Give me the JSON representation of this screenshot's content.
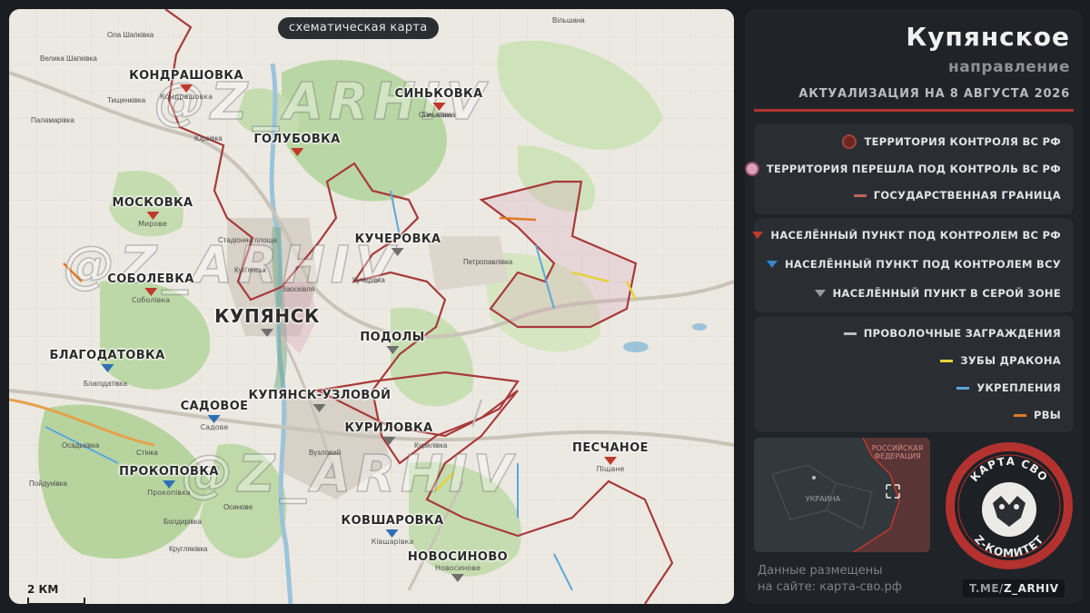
{
  "map": {
    "title": "схематическая карта",
    "scale_label": "2 КМ",
    "watermark": "@Z_ARHIV",
    "settlements": [
      {
        "name": "КОНДРАШОВКА",
        "sub": "Кондрашовка",
        "status": "ru",
        "big": false
      },
      {
        "name": "СИНЬКОВКА",
        "sub": "Сиьківка",
        "status": "ru",
        "big": false
      },
      {
        "name": "ГОЛУБОВКА",
        "sub": "",
        "status": "ru",
        "big": false
      },
      {
        "name": "МОСКОВКА",
        "sub": "Мирове",
        "status": "ru",
        "big": false
      },
      {
        "name": "КУЧЕРОВКА",
        "sub": "",
        "status": "gray",
        "big": false
      },
      {
        "name": "СОБОЛЕВКА",
        "sub": "Соболівка",
        "status": "ru",
        "big": false
      },
      {
        "name": "КУПЯНСК",
        "sub": "",
        "status": "gray",
        "big": true
      },
      {
        "name": "ПОДОЛЫ",
        "sub": "",
        "status": "gray",
        "big": false
      },
      {
        "name": "БЛАГОДАТОВКА",
        "sub": "",
        "status": "ua",
        "big": false
      },
      {
        "name": "САДОВОЕ",
        "sub": "Садове",
        "status": "ua",
        "big": false
      },
      {
        "name": "КУПЯНСК-УЗЛОВОЙ",
        "sub": "",
        "status": "gray",
        "big": false
      },
      {
        "name": "КУРИЛОВКА",
        "sub": "",
        "status": "gray",
        "big": false
      },
      {
        "name": "ПЕСЧАНОЕ",
        "sub": "Піщане",
        "status": "ru",
        "big": false
      },
      {
        "name": "ПРОКОПОВКА",
        "sub": "Прокопівка",
        "status": "ua",
        "big": false
      },
      {
        "name": "КОВШАРОВКА",
        "sub": "Ківшарівка",
        "status": "ua",
        "big": false
      },
      {
        "name": "НОВОСИНОВО",
        "sub": "Новосинове",
        "status": "gray",
        "big": false
      }
    ],
    "small_labels": [
      "Ола Шапківка",
      "Велика Шапківка",
      "Вільшана",
      "Синьківка",
      "Тищенківка",
      "Паламарівка",
      "Юрсівка",
      "Заосківля",
      "Петропавлівка",
      "Кучерівка",
      "Стадіонна площа",
      "Куп'янськ",
      "Осадьківка",
      "Стінка",
      "Пойдунівка",
      "Болдирівка",
      "Осинове",
      "Кругляківка",
      "Курилівка",
      "Вузловий",
      "Благодатівка"
    ]
  },
  "panel": {
    "title": "Купянское",
    "subtitle": "направление",
    "date": "АКТУАЛИЗАЦИЯ НА 8 АВГУСТА 2026",
    "legend_territory": [
      {
        "label": "ТЕРРИТОРИЯ КОНТРОЛЯ ВС РФ",
        "symbol": "dot",
        "color": "#7a2b27"
      },
      {
        "label": "ТЕРРИТОРИЯ ПЕРЕШЛА ПОД КОНТРОЛЬ ВС РФ",
        "symbol": "dot",
        "color": "#d9a0b7"
      },
      {
        "label": "ГОСУДАРСТВЕННАЯ ГРАНИЦА",
        "symbol": "dash",
        "color": "#c0625b"
      }
    ],
    "legend_settlements": [
      {
        "label": "НАСЕЛЁННЫЙ ПУНКТ ПОД КОНТРОЛЕМ ВС РФ",
        "color": "#c0392b"
      },
      {
        "label": "НАСЕЛЁННЫЙ ПУНКТ ПОД КОНТРОЛЕМ ВСУ",
        "color": "#3a85c9"
      },
      {
        "label": "НАСЕЛЁННЫЙ ПУНКТ В СЕРОЙ ЗОНЕ",
        "color": "#9a9a9a"
      }
    ],
    "legend_fortifications": [
      {
        "label": "ПРОВОЛОЧНЫЕ ЗАГРАЖДЕНИЯ",
        "color": "#bdbdbd"
      },
      {
        "label": "ЗУБЫ ДРАКОНА",
        "color": "#e3d23a"
      },
      {
        "label": "УКРЕПЛЕНИЯ",
        "color": "#5aa7dc"
      },
      {
        "label": "РВЫ",
        "color": "#e07a22"
      }
    ],
    "minimap": {
      "region_label_1": "РОССИЙСКАЯ",
      "region_label_2": "ФЕДЕРАЦИЯ",
      "country_label": "УКРАИНА"
    },
    "site_line1": "Данные размещены",
    "site_line2": "на сайте: карта-сво.рф",
    "tme_prefix": "T.ME/",
    "tme_handle": "Z_ARHIV",
    "logo_top": "КАРТА СВО",
    "logo_bottom": "Z-КОМИТЕТ"
  }
}
